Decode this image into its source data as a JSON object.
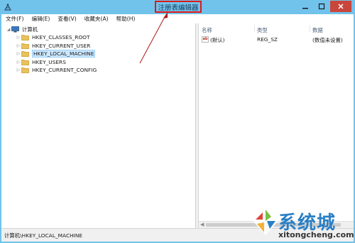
{
  "window": {
    "title": "注册表编辑器",
    "controls": {
      "minimize": "minimize",
      "maximize": "maximize",
      "close": "close"
    }
  },
  "menu": [
    {
      "label": "文件(F)"
    },
    {
      "label": "编辑(E)"
    },
    {
      "label": "查看(V)"
    },
    {
      "label": "收藏夹(A)"
    },
    {
      "label": "帮助(H)"
    }
  ],
  "tree": {
    "root": {
      "label": "计算机",
      "icon": "computer-icon",
      "expanded": true
    },
    "items": [
      {
        "label": "HKEY_CLASSES_ROOT",
        "selected": false
      },
      {
        "label": "HKEY_CURRENT_USER",
        "selected": false
      },
      {
        "label": "HKEY_LOCAL_MACHINE",
        "selected": true
      },
      {
        "label": "HKEY_USERS",
        "selected": false
      },
      {
        "label": "HKEY_CURRENT_CONFIG",
        "selected": false
      }
    ]
  },
  "values": {
    "columns": [
      "名称",
      "类型",
      "数据"
    ],
    "rows": [
      {
        "name": "(默认)",
        "type": "REG_SZ",
        "data": "(数值未设置)"
      }
    ]
  },
  "status": {
    "path": "计算机\\HKEY_LOCAL_MACHINE"
  },
  "watermark": {
    "title": "系统城",
    "url": "xitongcheng.com"
  },
  "colors": {
    "title_bar": "#71c3ec",
    "annotation_red": "#e01818",
    "close_button": "#c9463d",
    "selection": "#cce8ff",
    "folder": "#e8c25a"
  }
}
